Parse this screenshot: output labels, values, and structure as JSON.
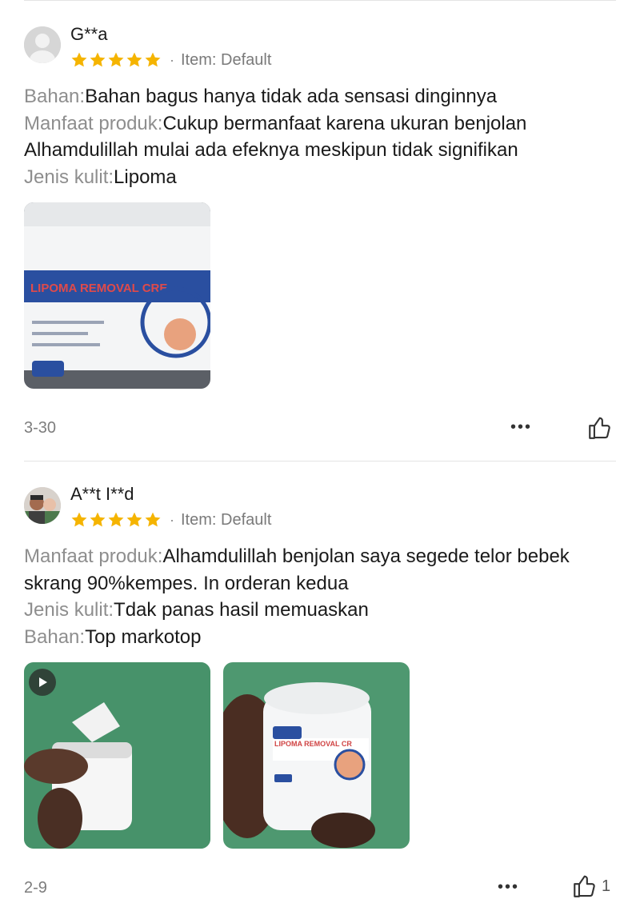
{
  "reviews": [
    {
      "username": "G**a",
      "rating": 5,
      "variant": "Item: Default",
      "lines": [
        {
          "label": "Bahan:",
          "text": "Bahan bagus hanya tidak ada sensasi dinginnya"
        },
        {
          "label": "Manfaat produk:",
          "text": "Cukup bermanfaat karena ukuran benjolan Alhamdulillah mulai ada efeknya meskipun tidak signifikan"
        },
        {
          "label": "Jenis kulit:",
          "text": "Lipoma"
        }
      ],
      "photo_text": "LIPOMA REMOVAL CRE",
      "date": "3-30",
      "more": "•••",
      "likes": ""
    },
    {
      "username": "A**t I**d",
      "rating": 5,
      "variant": "Item: Default",
      "lines": [
        {
          "label": "Manfaat produk:",
          "text": "Alhamdulillah benjolan saya segede telor bebek skrang 90%kempes. In orderan kedua"
        },
        {
          "label": "Jenis kulit:",
          "text": "Tdak panas hasil memuaskan"
        },
        {
          "label": "Bahan:",
          "text": "Top markotop"
        }
      ],
      "photo_text": "LIPOMA REMOVAL CR",
      "date": "2-9",
      "more": "•••",
      "likes": "1"
    }
  ],
  "icons": {
    "star": "star-icon",
    "like": "thumbs-up-icon",
    "more": "more-icon",
    "play": "play-icon"
  },
  "colors": {
    "star": "#f5b400",
    "label": "#8e8e8e",
    "text": "#1a1a1a"
  }
}
